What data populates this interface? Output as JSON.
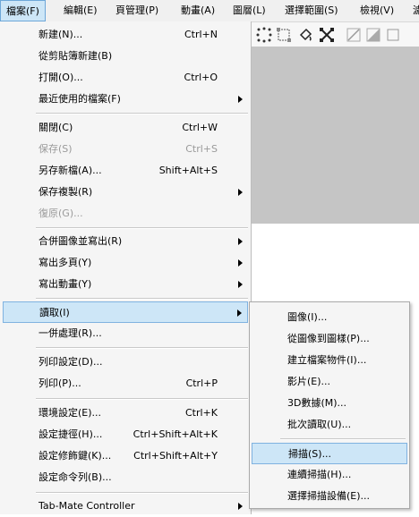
{
  "menubar": {
    "items": [
      "檔案(F)",
      "編輯(E)",
      "頁管理(P)",
      "動畫(A)",
      "圖層(L)",
      "選擇範圍(S)",
      "檢視(V)",
      "濾"
    ]
  },
  "file_menu": {
    "new": {
      "label": "新建(N)...",
      "shortcut": "Ctrl+N"
    },
    "new_from_clipboard": {
      "label": "從剪貼簿新建(B)"
    },
    "open": {
      "label": "打開(O)...",
      "shortcut": "Ctrl+O"
    },
    "recent": {
      "label": "最近使用的檔案(F)"
    },
    "close": {
      "label": "關閉(C)",
      "shortcut": "Ctrl+W"
    },
    "save": {
      "label": "保存(S)",
      "shortcut": "Ctrl+S"
    },
    "save_as": {
      "label": "另存新檔(A)...",
      "shortcut": "Shift+Alt+S"
    },
    "save_copy": {
      "label": "保存複製(R)"
    },
    "revert": {
      "label": "復原(G)..."
    },
    "merge_export": {
      "label": "合併圖像並寫出(R)"
    },
    "export_multiple": {
      "label": "寫出多頁(Y)"
    },
    "export_animation": {
      "label": "寫出動畫(Y)"
    },
    "import": {
      "label": "讀取(I)"
    },
    "batch": {
      "label": "一併處理(R)..."
    },
    "print_settings": {
      "label": "列印設定(D)..."
    },
    "print": {
      "label": "列印(P)...",
      "shortcut": "Ctrl+P"
    },
    "preferences": {
      "label": "環境設定(E)...",
      "shortcut": "Ctrl+K"
    },
    "shortcut_settings": {
      "label": "設定捷徑(H)...",
      "shortcut": "Ctrl+Shift+Alt+K"
    },
    "modifier_settings": {
      "label": "設定修飾鍵(K)...",
      "shortcut": "Ctrl+Shift+Alt+Y"
    },
    "command_bar": {
      "label": "設定命令列(B)..."
    },
    "tabmate": {
      "label": "Tab-Mate Controller"
    }
  },
  "import_submenu": {
    "image": "圖像(I)...",
    "image_to_pattern": "從圖像到圖樣(P)...",
    "file_object": "建立檔案物件(I)...",
    "video": "影片(E)...",
    "data_3d": "3D數據(M)...",
    "batch_import": "批次讀取(U)...",
    "scan": "掃描(S)...",
    "continuous_scan": "連續掃描(H)...",
    "select_scanner": "選擇掃描設備(E)..."
  },
  "toolbar": {
    "icons": [
      "transform-dots-icon",
      "selection-frame-icon",
      "fill-bucket-icon",
      "move-cross-icon",
      "line-slash-icon",
      "gradient-icon",
      "rectangle-icon"
    ]
  },
  "colors": {
    "highlight": "#cde6f7",
    "highlight_border": "#7fb2e0",
    "canvas_gray": "#c5c5c5",
    "menu_bg": "#f5f5f5"
  }
}
